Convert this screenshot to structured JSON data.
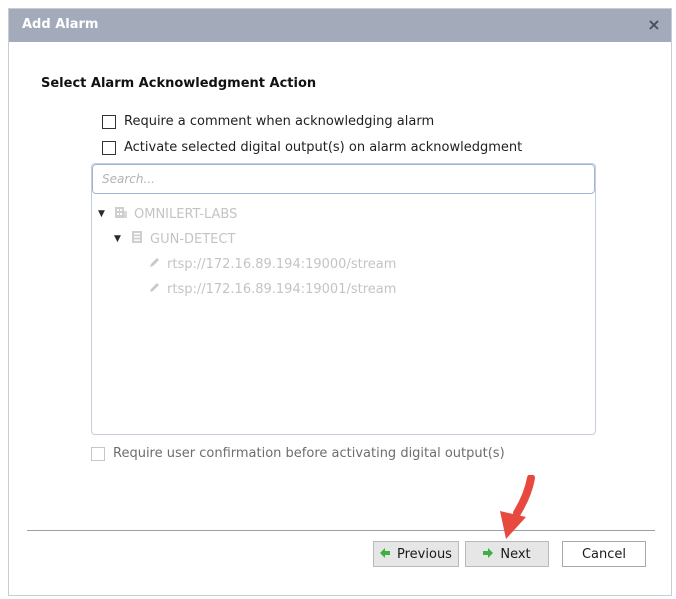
{
  "dialog": {
    "title": "Add Alarm",
    "close_glyph": "×"
  },
  "section_title": "Select Alarm Acknowledgment Action",
  "options": {
    "require_comment": {
      "label": "Require a comment when acknowledging alarm",
      "checked": false
    },
    "activate_outputs": {
      "label": "Activate selected digital output(s) on alarm acknowledgment",
      "checked": false
    },
    "require_confirmation": {
      "label": "Require user confirmation before activating digital output(s)",
      "checked": false,
      "disabled": true
    }
  },
  "search": {
    "placeholder": "Search..."
  },
  "tree": {
    "root": {
      "label": "OMNILERT-LABS",
      "icon": "building-icon"
    },
    "server": {
      "label": "GUN-DETECT",
      "icon": "server-icon"
    },
    "streams": [
      {
        "label": "rtsp://172.16.89.194:19000/stream",
        "icon": "pencil-icon"
      },
      {
        "label": "rtsp://172.16.89.194:19001/stream",
        "icon": "pencil-icon"
      }
    ]
  },
  "buttons": {
    "previous": "Previous",
    "next": "Next",
    "cancel": "Cancel"
  },
  "colors": {
    "titlebar": "#a3abba",
    "nav_arrow": "#3cb043",
    "annotation_arrow": "#e8493f"
  }
}
